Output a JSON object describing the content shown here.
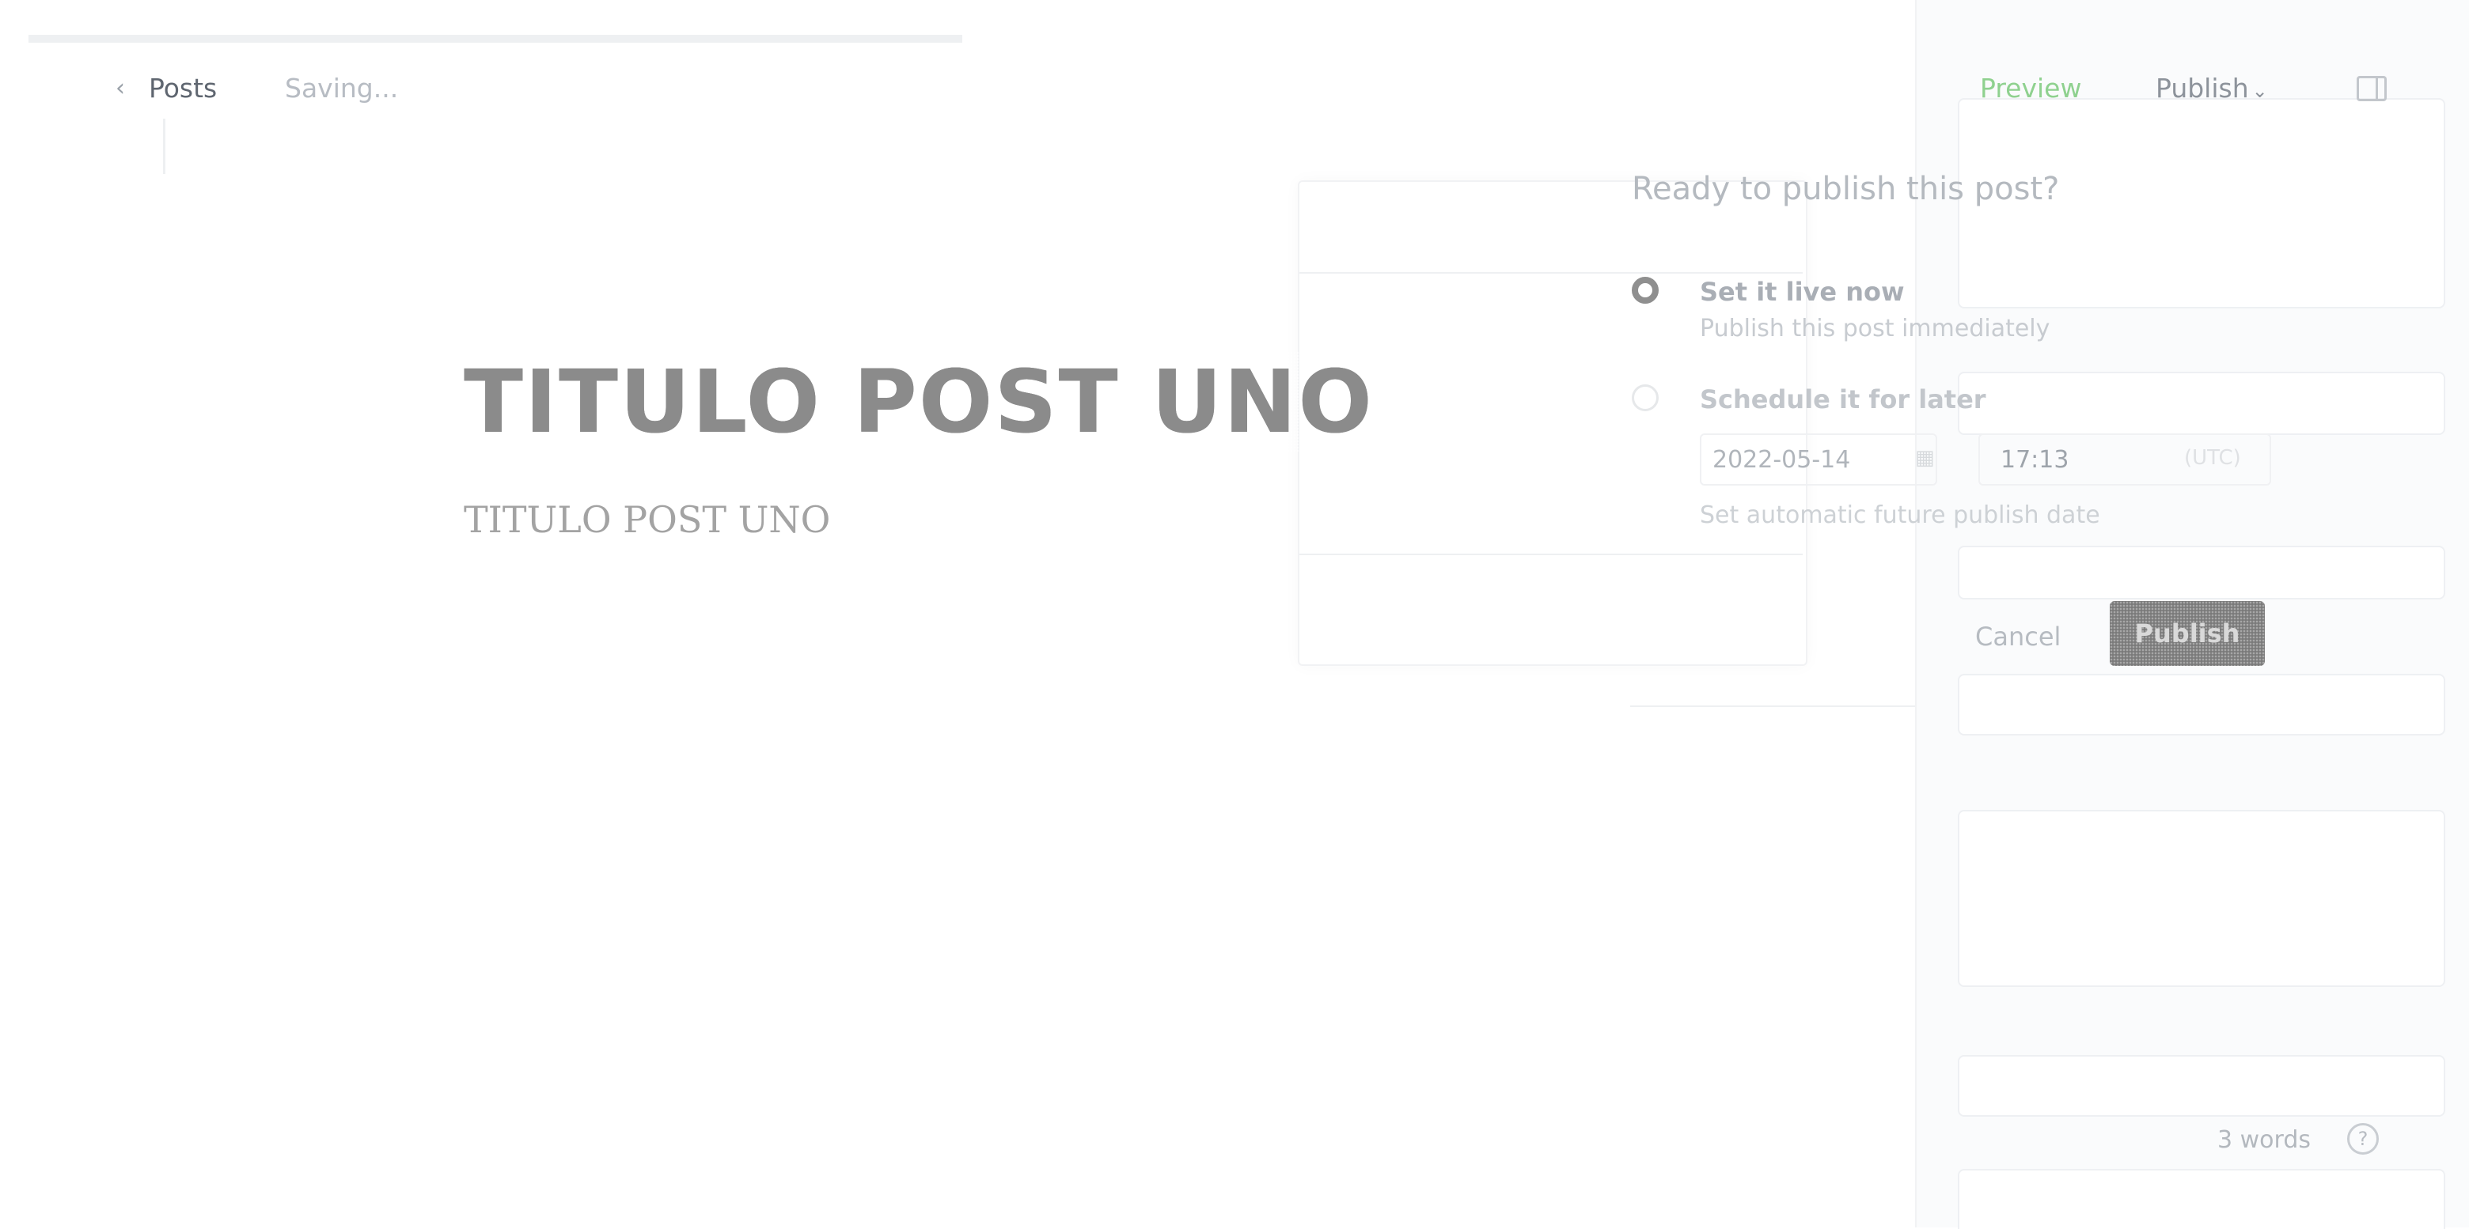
{
  "topbar": {
    "back_label": "Posts",
    "status": "Saving...",
    "preview_label": "Preview",
    "publish_label": "Publish"
  },
  "editor": {
    "title": "TITULO POST UNO",
    "body": "TITULO POST UNO"
  },
  "publish_menu": {
    "heading": "Ready to publish this post?",
    "options": [
      {
        "label": "Set it live now",
        "description": "Publish this post immediately",
        "selected": true
      },
      {
        "label": "Schedule it for later",
        "selected": false
      }
    ],
    "date": "2022-05-14",
    "time": "17:13",
    "timezone": "(UTC)",
    "hint": "Set automatic future publish date",
    "cancel_label": "Cancel",
    "publish_label": "Publish"
  },
  "footer": {
    "word_count": "3 words",
    "help_symbol": "?"
  },
  "icons": {
    "back": "chevron-left-icon",
    "publish_dropdown": "chevron-down-icon",
    "sidebar": "sidebar-toggle-icon",
    "calendar": "calendar-icon",
    "help": "help-icon"
  },
  "colors": {
    "preview_accent": "#8fd18f",
    "publish_button": "#7a7a7a"
  }
}
